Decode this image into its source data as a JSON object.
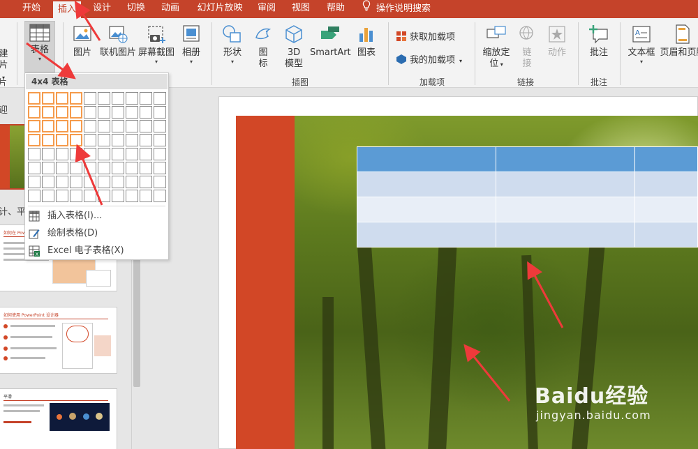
{
  "tabs": [
    {
      "label": "开始"
    },
    {
      "label": "插入"
    },
    {
      "label": "设计"
    },
    {
      "label": "切换"
    },
    {
      "label": "动画"
    },
    {
      "label": "幻灯片放映"
    },
    {
      "label": "审阅"
    },
    {
      "label": "视图"
    },
    {
      "label": "帮助"
    }
  ],
  "active_tab": "插入",
  "tell_me": "操作说明搜索",
  "ribbon": {
    "slides_partial_top": "建",
    "slides_partial_bottom": "片",
    "slides_partial_group": "片",
    "table": "表格",
    "picture": "图片",
    "online_picture": "联机图片",
    "screenshot": "屏幕截图",
    "album": "相册",
    "shapes": "形状",
    "icons": "图\n标",
    "icons_line1": "图",
    "icons_line2": "标",
    "model3d_line1": "3D",
    "model3d_line2": "模型",
    "smartart": "SmartArt",
    "chart": "图表",
    "get_addins": "获取加载项",
    "my_addins": "我的加载项",
    "zoom_line1": "缩放定",
    "zoom_line2": "位",
    "link_line1": "链",
    "link_line2": "接",
    "action": "动作",
    "comment": "批注",
    "textbox": "文本框",
    "header_footer": "页眉和页脚",
    "groups": {
      "illustrations": "插图",
      "addins": "加载项",
      "links": "链接",
      "comments": "批注"
    }
  },
  "left_pane": {
    "section1": "迎",
    "section2": "计、平",
    "thumb2_title": "如何在 PowerPoint 中制",
    "thumb3_title": "如何使用 PowerPoint 设计器",
    "thumb4_title": "平滑"
  },
  "dropdown": {
    "header": "4x4 表格",
    "rows": 8,
    "cols": 10,
    "selected_rows": 4,
    "selected_cols": 4,
    "items": [
      {
        "label": "插入表格(I)...",
        "icon": "table-grid-icon"
      },
      {
        "label": "绘制表格(D)",
        "icon": "draw-table-pencil-icon"
      },
      {
        "label": "Excel 电子表格(X)",
        "icon": "excel-icon"
      }
    ]
  },
  "watermark": {
    "brand": "Baidu经验",
    "url": "jingyan.baidu.com"
  },
  "colors": {
    "accent": "#c5432a",
    "slide_red": "#d24726",
    "table_header": "#5b9bd5",
    "grid_highlight": "#f59b4c",
    "arrow": "#ee3a3a"
  }
}
